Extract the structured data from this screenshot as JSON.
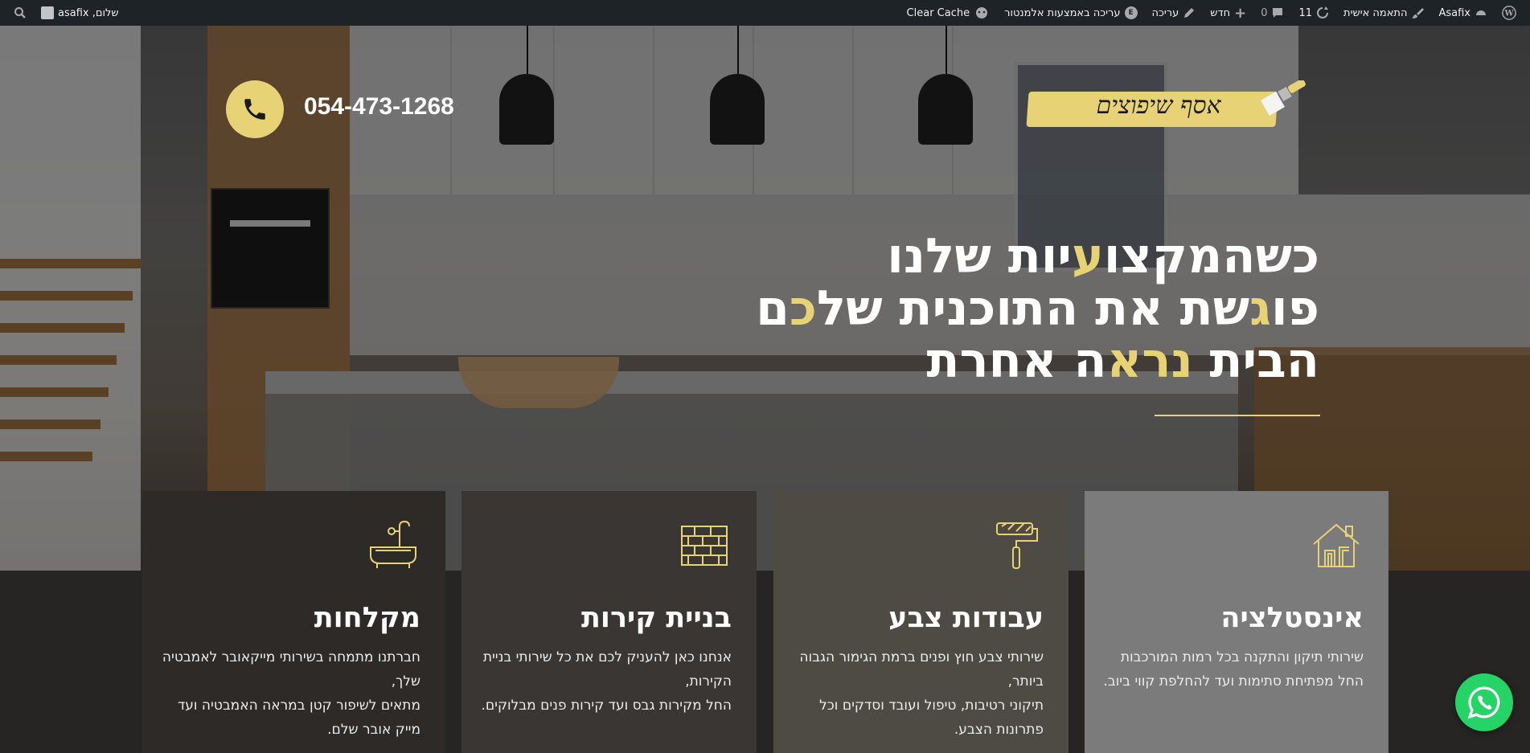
{
  "admin_bar": {
    "site_name": "Asafix",
    "customize": "התאמה אישית",
    "updates_count": "11",
    "comments_count": "0",
    "new_label": "חדש",
    "edit_label": "עריכה",
    "elementor_label": "עריכה באמצעות אלמנטור",
    "clear_cache": "Clear Cache",
    "greeting": "שלום, asafix"
  },
  "header": {
    "logo_text": "אסף שיפוצים",
    "phone": "054-473-1268"
  },
  "hero": {
    "line1": {
      "a": "כשהמקצו",
      "b": "ע",
      "c": "יות שלנו"
    },
    "line2": {
      "a": "פו",
      "b": "ג",
      "c": "שת את התוכנית של",
      "d": "כ",
      "e": "ם"
    },
    "line3": {
      "a": "הבית ",
      "b": "נרא",
      "c": "ה אחרת"
    }
  },
  "services": [
    {
      "title": "אינסטלציה",
      "desc": "שירותי תיקון והתקנה בכל רמות המורכבות\nהחל מפתיחת סתימות ועד להחלפת קווי ביוב.",
      "icon": "house-pipes-icon"
    },
    {
      "title": "עבודות צבע",
      "desc": "שירותי צבע חוץ ופנים ברמת הגימור הגבוה ביותר,\nתיקוני רטיבות, טיפול ועובד וסדקים וכל פתרונות הצבע.",
      "icon": "paint-roller-icon"
    },
    {
      "title": "בניית קירות",
      "desc": "אנחנו כאן להעניק לכם את כל שירותי בניית הקירות,\nהחל מקירות גבס ועד קירות פנים מבלוקים.",
      "icon": "brick-wall-icon"
    },
    {
      "title": "מקלחות",
      "desc": "חברתנו מתמחה בשירותי מייקאובר לאמבטיה שלך,\nמתאים לשיפור קטן במראה האמבטיה ועד מייק אובר שלם.",
      "icon": "bathtub-icon"
    }
  ],
  "colors": {
    "accent": "#e7d276",
    "card1": "#7b7b7b",
    "card2": "#4e4b45",
    "card3": "#3a3633",
    "card4": "#2d2a27",
    "whatsapp": "#25d366"
  }
}
